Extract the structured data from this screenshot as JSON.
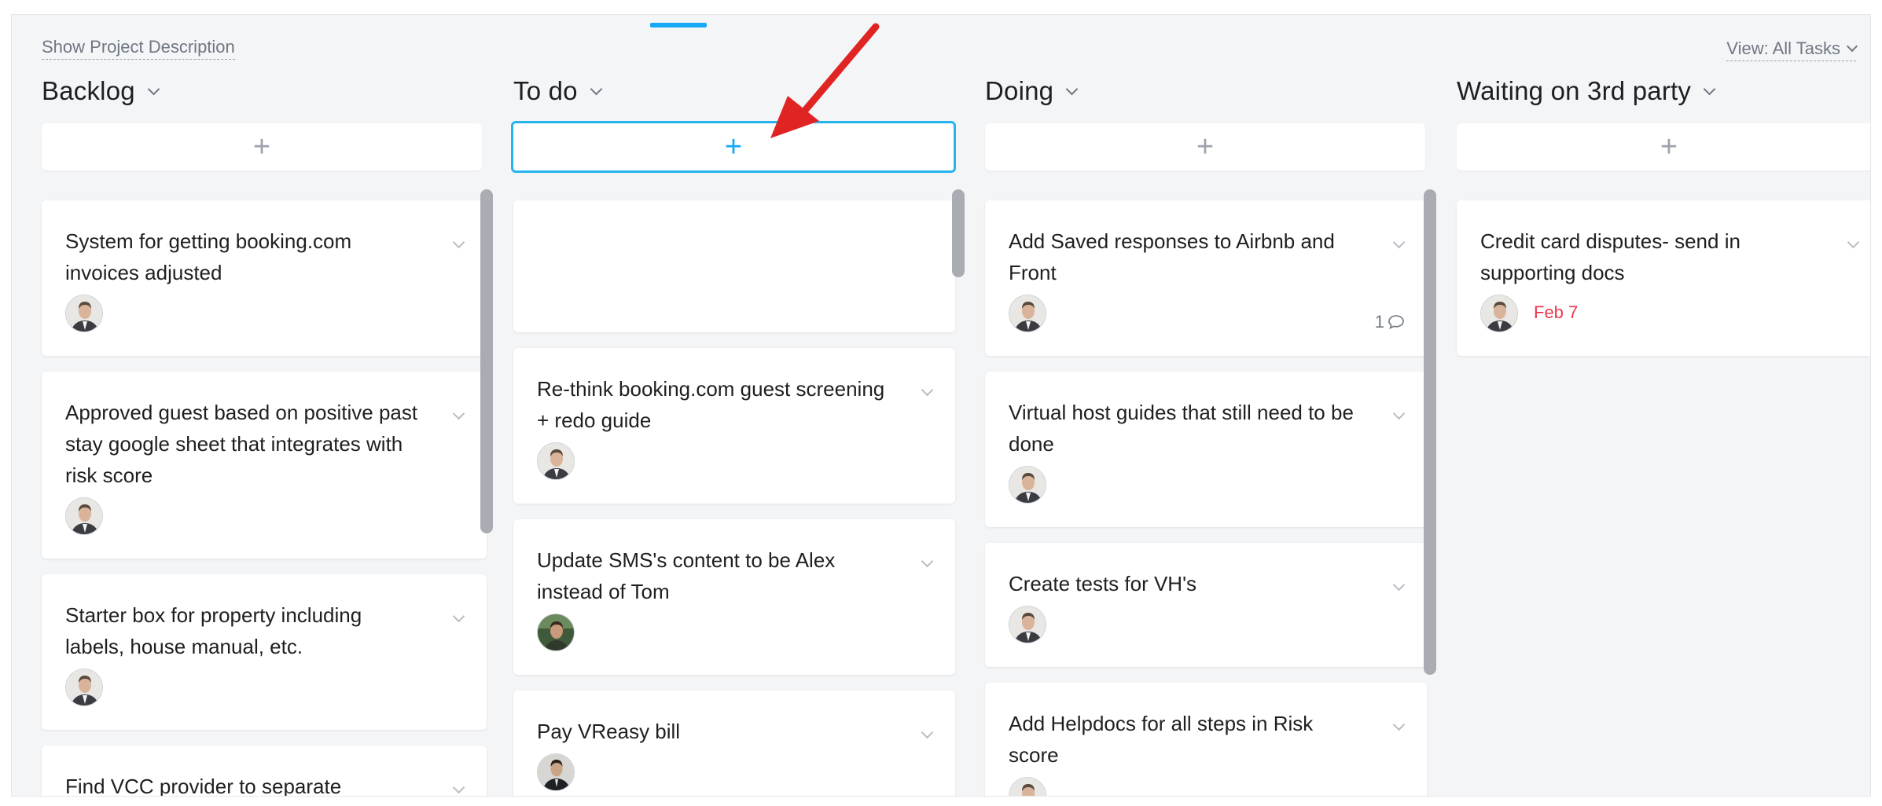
{
  "header": {
    "show_description_label": "Show Project Description",
    "view_filter_label": "View: All Tasks"
  },
  "colors": {
    "accent": "#14aaf5",
    "due_date": "#e8384f",
    "annotation_arrow": "#e02424"
  },
  "columns": [
    {
      "title": "Backlog",
      "cards": [
        {
          "text": "System for getting booking.com invoices adjusted",
          "avatar": "man-in-suit"
        },
        {
          "text": "Approved guest based on positive past stay google sheet that integrates with risk score",
          "avatar": "man-in-suit"
        },
        {
          "text": "Starter box for property including labels, house manual, etc.",
          "avatar": "man-in-suit"
        },
        {
          "text": "Find VCC provider to separate"
        }
      ]
    },
    {
      "title": "To do",
      "cards": [
        {
          "text": ""
        },
        {
          "text": "Re-think booking.com guest screening + redo guide",
          "avatar": "man-in-suit"
        },
        {
          "text": "Update SMS's content to be Alex instead of Tom",
          "avatar": "man-outdoors"
        },
        {
          "text": "Pay VReasy bill",
          "avatar": "man-dark-suit"
        }
      ]
    },
    {
      "title": "Doing",
      "cards": [
        {
          "text": "Add Saved responses to Airbnb and Front",
          "avatar": "man-in-suit",
          "comments": "1"
        },
        {
          "text": "Virtual host guides that still need to be done",
          "avatar": "man-in-suit"
        },
        {
          "text": "Create tests for VH's",
          "avatar": "man-in-suit"
        },
        {
          "text": "Add Helpdocs for all steps in Risk score",
          "avatar": "man-in-suit"
        }
      ]
    },
    {
      "title": "Waiting on 3rd party",
      "cards": [
        {
          "text": "Credit card disputes- send in supporting docs",
          "avatar": "man-in-suit",
          "due": "Feb 7"
        }
      ]
    }
  ]
}
